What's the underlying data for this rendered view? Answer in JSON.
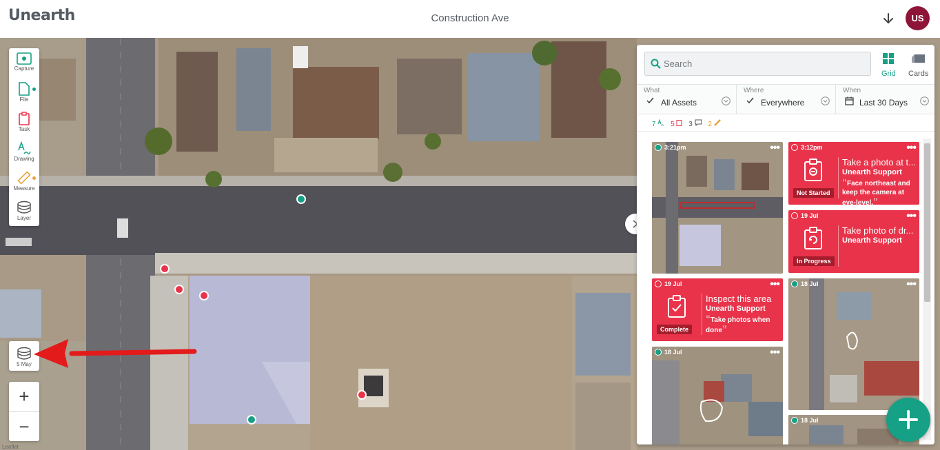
{
  "app": {
    "logo": "Unearth",
    "title": "Construction Ave",
    "avatar_initials": "US",
    "avatar_color": "#8e1538"
  },
  "toolbar": {
    "items": [
      {
        "label": "Capture",
        "icon": "capture-icon"
      },
      {
        "label": "File",
        "icon": "file-icon"
      },
      {
        "label": "Task",
        "icon": "task-icon"
      },
      {
        "label": "Drawing",
        "icon": "drawing-icon"
      },
      {
        "label": "Measure",
        "icon": "measure-icon"
      },
      {
        "label": "Layer",
        "icon": "layer-icon"
      }
    ]
  },
  "layer_date": "5 May",
  "zoom": {
    "in": "+",
    "out": "−"
  },
  "map": {
    "attribution": "Leaflet"
  },
  "panel": {
    "search_placeholder": "Search",
    "views": {
      "grid": "Grid",
      "cards": "Cards"
    },
    "filters": {
      "what": {
        "label": "What",
        "value": "All Assets"
      },
      "where": {
        "label": "Where",
        "value": "Everywhere"
      },
      "when": {
        "label": "When",
        "value": "Last 30 Days"
      }
    },
    "counts": {
      "drawings": "7",
      "tasks": "5",
      "comments": "3",
      "measures": "2"
    },
    "cards": [
      {
        "type": "photo",
        "time": "3:21pm"
      },
      {
        "type": "task",
        "time": "3:12pm",
        "status": "Not Started",
        "title": "Take a photo at t...",
        "author": "Unearth Support",
        "desc": "Face northeast and keep the camera at eye-level."
      },
      {
        "type": "task",
        "time": "19 Jul",
        "status": "In Progress",
        "title": "Take photo of dr...",
        "author": "Unearth Support",
        "desc": ""
      },
      {
        "type": "task",
        "time": "19 Jul",
        "status": "Complete",
        "title": "Inspect this area",
        "author": "Unearth Support",
        "desc": "Take photos when done"
      },
      {
        "type": "photo",
        "time": "18 Jul"
      },
      {
        "type": "photo",
        "time": "18 Jul"
      },
      {
        "type": "photo",
        "time": "18 Jul"
      }
    ]
  },
  "colors": {
    "accent": "#16a085",
    "task_red": "#e8334a",
    "status_dark": "#a51d2d"
  }
}
